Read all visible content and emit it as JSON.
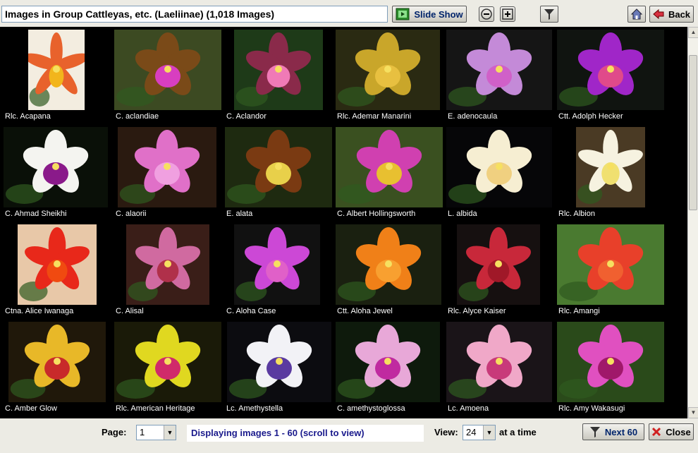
{
  "toolbar": {
    "title": "Images in Group Cattleyas, etc. (Laeliinae) (1,018 Images)",
    "slideshow_label": "Slide Show",
    "back_label": "Back"
  },
  "thumbnails": [
    {
      "label": "Rlc. Acapana",
      "bg": "#f3ede0",
      "flower": "#e8622c",
      "lip": "#f2b51c"
    },
    {
      "label": "C. aclandiae",
      "bg": "#3c4a22",
      "flower": "#7a4a18",
      "lip": "#d83ec0"
    },
    {
      "label": "C. Aclandor",
      "bg": "#1e3a18",
      "flower": "#8a2a4a",
      "lip": "#f07ab6"
    },
    {
      "label": "Rlc. Ademar Manarini",
      "bg": "#2a2a12",
      "flower": "#c9a62a",
      "lip": "#e8c040"
    },
    {
      "label": "E. adenocaula",
      "bg": "#151515",
      "flower": "#c48ad8",
      "lip": "#d060c8"
    },
    {
      "label": "Ctt. Adolph Hecker",
      "bg": "#101410",
      "flower": "#a026c8",
      "lip": "#e04a8a"
    },
    {
      "label": "C. Ahmad Sheikhi",
      "bg": "#0a1008",
      "flower": "#f4f4f0",
      "lip": "#8a1a8a"
    },
    {
      "label": "C. alaorii",
      "bg": "#2a1a10",
      "flower": "#e070c8",
      "lip": "#f0a0e0"
    },
    {
      "label": "E. alata",
      "bg": "#1e2a10",
      "flower": "#7a3a12",
      "lip": "#e8d04a"
    },
    {
      "label": "C. Albert Hollingsworth",
      "bg": "#3a5020",
      "flower": "#d040b0",
      "lip": "#e8c030"
    },
    {
      "label": "L. albida",
      "bg": "#060608",
      "flower": "#f6eed2",
      "lip": "#f0d080"
    },
    {
      "label": "Rlc. Albion",
      "bg": "#4a3a24",
      "flower": "#f6f2e0",
      "lip": "#f0e070"
    },
    {
      "label": "Ctna. Alice Iwanaga",
      "bg": "#e8c8a8",
      "flower": "#e8281a",
      "lip": "#f04a10"
    },
    {
      "label": "C. Alisal",
      "bg": "#3a1e18",
      "flower": "#d06aa0",
      "lip": "#b0304a"
    },
    {
      "label": "C. Aloha Case",
      "bg": "#111111",
      "flower": "#cc48d6",
      "lip": "#e060c8"
    },
    {
      "label": "Ctt. Aloha Jewel",
      "bg": "#1a2010",
      "flower": "#f08018",
      "lip": "#f8a030"
    },
    {
      "label": "Rlc. Alyce Kaiser",
      "bg": "#161010",
      "flower": "#c8283a",
      "lip": "#a01828"
    },
    {
      "label": "Rlc. Amangi",
      "bg": "#4a7a30",
      "flower": "#e8402a",
      "lip": "#f06030"
    },
    {
      "label": "C. Amber Glow",
      "bg": "#20180a",
      "flower": "#e8b828",
      "lip": "#c82a2a"
    },
    {
      "label": "Rlc. American Heritage",
      "bg": "#1a1a08",
      "flower": "#e0d820",
      "lip": "#d02a6a"
    },
    {
      "label": "Lc. Amethystella",
      "bg": "#0c0c10",
      "flower": "#f2f2f6",
      "lip": "#5a3aa0"
    },
    {
      "label": "C. amethystoglossa",
      "bg": "#0e1a0c",
      "flower": "#e8a8d8",
      "lip": "#c02aa0"
    },
    {
      "label": "Lc. Amoena",
      "bg": "#1a1418",
      "flower": "#f0a8c8",
      "lip": "#c83a7a"
    },
    {
      "label": "Rlc. Amy Wakasugi",
      "bg": "#2a4a1a",
      "flower": "#e050c0",
      "lip": "#a0186a"
    }
  ],
  "bottom": {
    "page_label": "Page:",
    "page_value": "1",
    "status": "Displaying images 1 - 60 (scroll to view)",
    "view_label": "View:",
    "view_value": "24",
    "view_suffix": "at a time",
    "next_label": "Next 60",
    "close_label": "Close"
  },
  "colors": {
    "accent": "#00246b",
    "status_text": "#1a1a8c",
    "close_icon": "#d02020"
  }
}
